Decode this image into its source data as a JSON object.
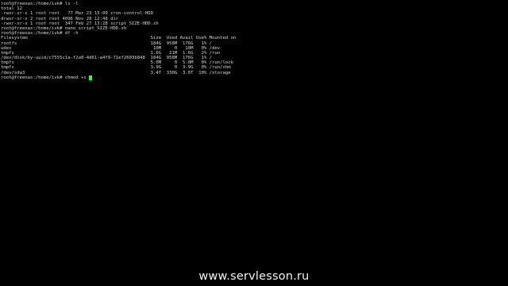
{
  "terminal": {
    "lines": [
      "root@freenas:/home/ivk# ls -l",
      "total 12",
      "-rwxr-xr-x 1 root root   77 Mar 23 15:00 cron-control-HDD",
      "drwxr-xr-x 2 root root 4096 Nov 28 12:48 dir",
      "-rwxr-xr-x 1 root root  347 Feb 27 13:28 script_SIZE-HDD.sh",
      "root@freenas:/home/ivk# nano script_SIZE-HDD.sh",
      "root@freenas:/home/ivk# df -h",
      "Filesystem                                              Size  Used Avail Use% Mounted on",
      "rootfs                                                  184G  958M  176G   1% /",
      "udev                                                     10M     0   10M   0% /dev",
      "tmpfs                                                   1.6G   21M  1.6G   2% /run",
      "/dev/disk/by-uuid/c7555c1a-f2a0-4d61-a4f9-71ef2603b848  184G  958M  176G   1% /",
      "tmpfs                                                   5.0M     0  5.0M   0% /run/lock",
      "tmpfs                                                   3.9G     0  3.9G   0% /run/shm",
      "/dev/sda3                                               3.4T  330G  3.0T  10% /storage"
    ],
    "prompt_line": "root@freenas:/home/ivk# chmod +x "
  },
  "watermark": "www.servlesson.ru",
  "colors": {
    "background": "#000000",
    "text": "#d8d8d8",
    "cursor": "#33ff33",
    "watermark": "#f2f2f2"
  }
}
